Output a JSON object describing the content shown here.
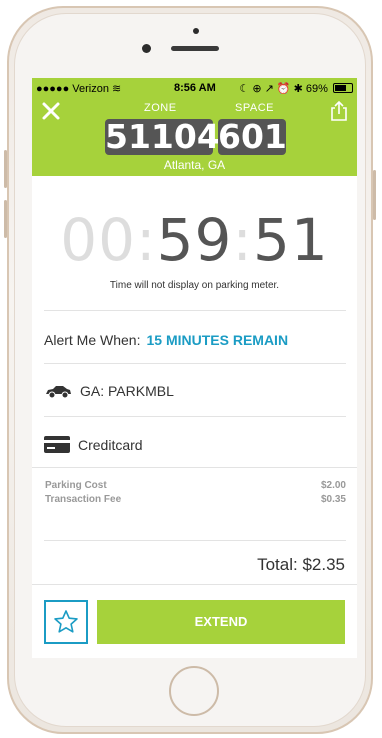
{
  "status_bar": {
    "carrier": "●●●●● Verizon ≋",
    "time": "8:56 AM",
    "right_icons": "☾ ⊕ ↗ ⏰ ✱ 69%"
  },
  "session": {
    "zone_label": "ZONE",
    "space_label": "SPACE",
    "zone": "51104",
    "space": "601",
    "city": "Atlanta, GA"
  },
  "timer": {
    "hours": "00",
    "minutes": "59",
    "seconds": "51",
    "note": "Time will not display on parking meter."
  },
  "alert": {
    "label": "Alert Me When:",
    "value": "15 MINUTES REMAIN"
  },
  "vehicle": {
    "plate": "GA: PARKMBL",
    "icon": "car-icon"
  },
  "payment": {
    "method": "Creditcard",
    "icon": "credit-card-icon"
  },
  "costs": [
    {
      "label": "Parking Cost",
      "value": "$2.00"
    },
    {
      "label": "Transaction Fee",
      "value": "$0.35"
    }
  ],
  "total": "Total: $2.35",
  "actions": {
    "extend_label": "EXTEND",
    "favorite_icon": "star-icon"
  },
  "colors": {
    "brand_green": "#a6d23b",
    "accent_blue": "#1b9cc4",
    "plate_box": "#555555"
  }
}
